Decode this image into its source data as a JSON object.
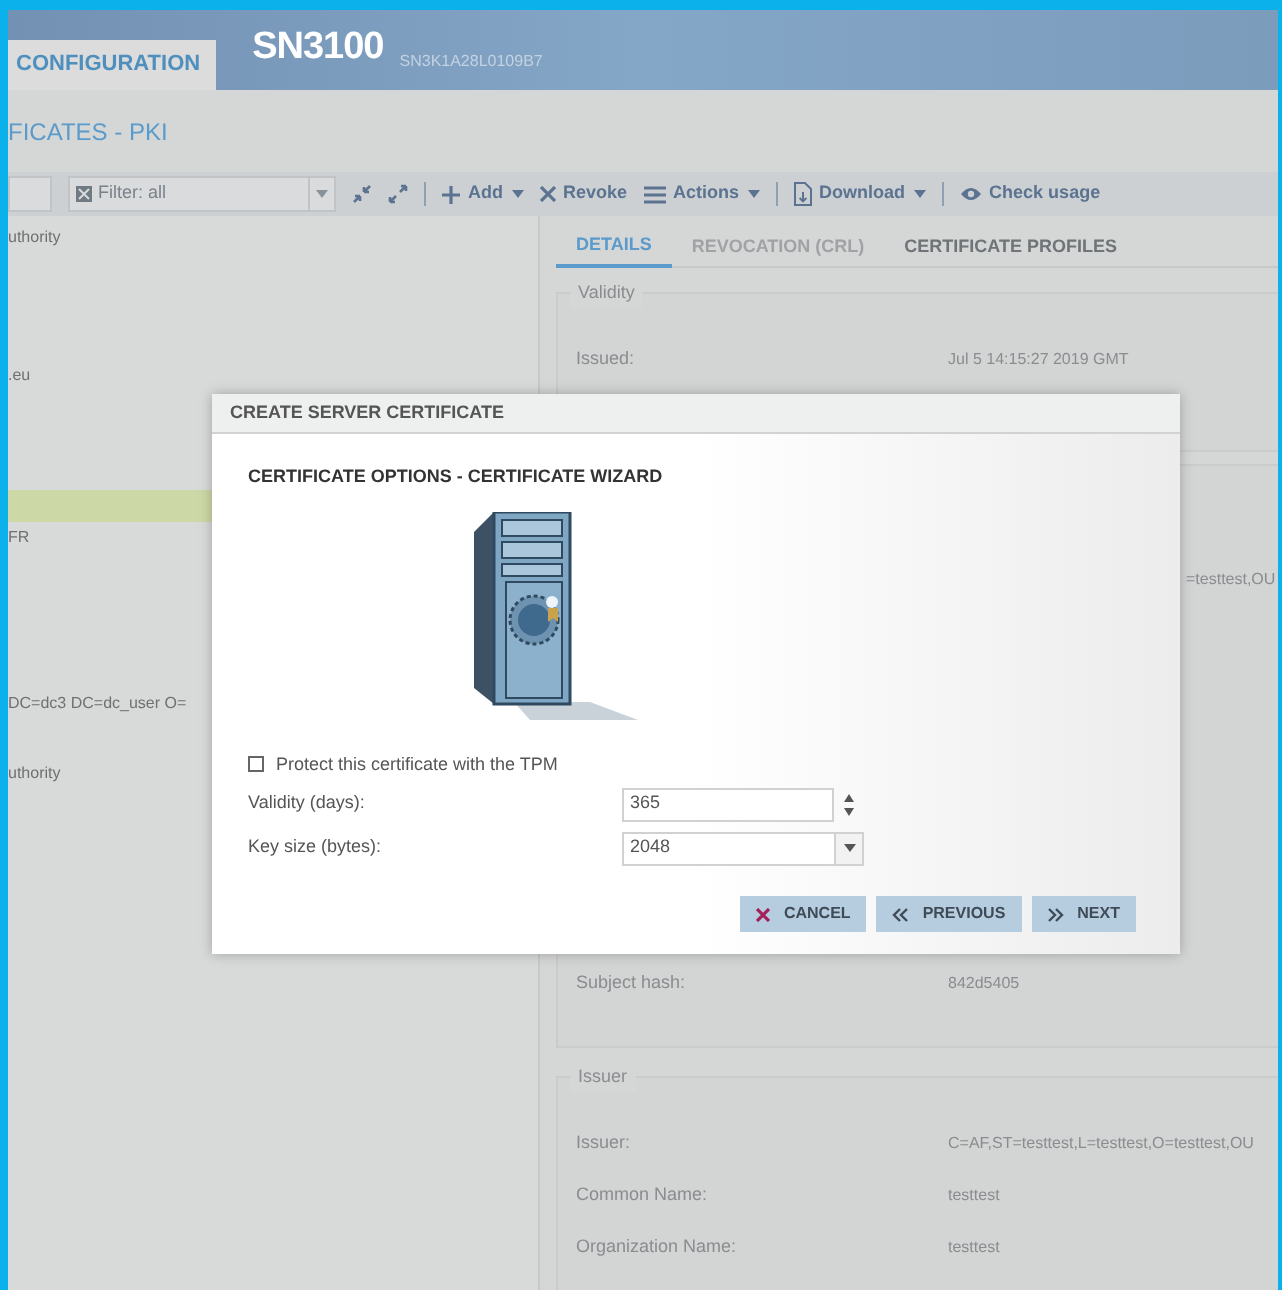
{
  "header": {
    "tab": "CONFIGURATION",
    "title": "SN3100",
    "serial": "SN3K1A28L0109B7"
  },
  "page_title": "FICATES - PKI",
  "toolbar": {
    "filter": "Filter: all",
    "items": [
      {
        "kind": "collapse"
      },
      {
        "kind": "expand"
      },
      {
        "kind": "separator"
      },
      {
        "kind": "add",
        "label": "Add",
        "menu": true
      },
      {
        "kind": "revoke",
        "label": "Revoke",
        "menu": false
      },
      {
        "kind": "actions",
        "label": "Actions",
        "menu": true
      },
      {
        "kind": "separator"
      },
      {
        "kind": "download",
        "label": "Download",
        "menu": true
      },
      {
        "kind": "separator"
      },
      {
        "kind": "check",
        "label": "Check usage",
        "menu": false
      }
    ]
  },
  "tree": [
    {
      "label": "uthority",
      "selected": false
    },
    {
      "label": ".eu",
      "selected": false
    },
    {
      "selected": true
    },
    {
      "label": "FR",
      "selected": false
    },
    {
      "label": "DC=dc3 DC=dc_user O=",
      "selected": false
    },
    {
      "label": "uthority",
      "selected": false
    }
  ],
  "tabs": [
    {
      "label": "DETAILS",
      "selected": true,
      "disabled": false
    },
    {
      "label": "REVOCATION (CRL)",
      "selected": false,
      "disabled": true
    },
    {
      "label": "CERTIFICATE PROFILES",
      "selected": false,
      "disabled": false
    }
  ],
  "sections": [
    {
      "title": "Validity",
      "rows": [
        {
          "label": "Issued:",
          "value": "Jul 5 14:15:27 2019 GMT"
        }
      ]
    },
    {
      "rows": [
        {
          "value_tail": "=testtest,OU"
        },
        {
          "label": "Subject hash:",
          "value": "842d5405"
        }
      ]
    },
    {
      "title": "Issuer",
      "rows": [
        {
          "label": "Issuer:",
          "value": "C=AF,ST=testtest,L=testtest,O=testtest,OU"
        },
        {
          "label": "Common Name:",
          "value": "testtest"
        },
        {
          "label": "Organization Name:",
          "value": "testtest"
        }
      ]
    }
  ],
  "dialog": {
    "title": "CREATE SERVER CERTIFICATE",
    "heading": "CERTIFICATE OPTIONS - CERTIFICATE WIZARD",
    "tpm": {
      "label": "Protect this certificate with the TPM",
      "checked": false
    },
    "fields": [
      {
        "kind": "spinner",
        "label": "Validity (days):",
        "value": "365"
      },
      {
        "kind": "select",
        "label": "Key size (bytes):",
        "value": "2048"
      }
    ],
    "buttons": [
      {
        "kind": "cancel",
        "label": "CANCEL"
      },
      {
        "kind": "previous",
        "label": "PREVIOUS"
      },
      {
        "kind": "next",
        "label": "NEXT"
      }
    ]
  }
}
